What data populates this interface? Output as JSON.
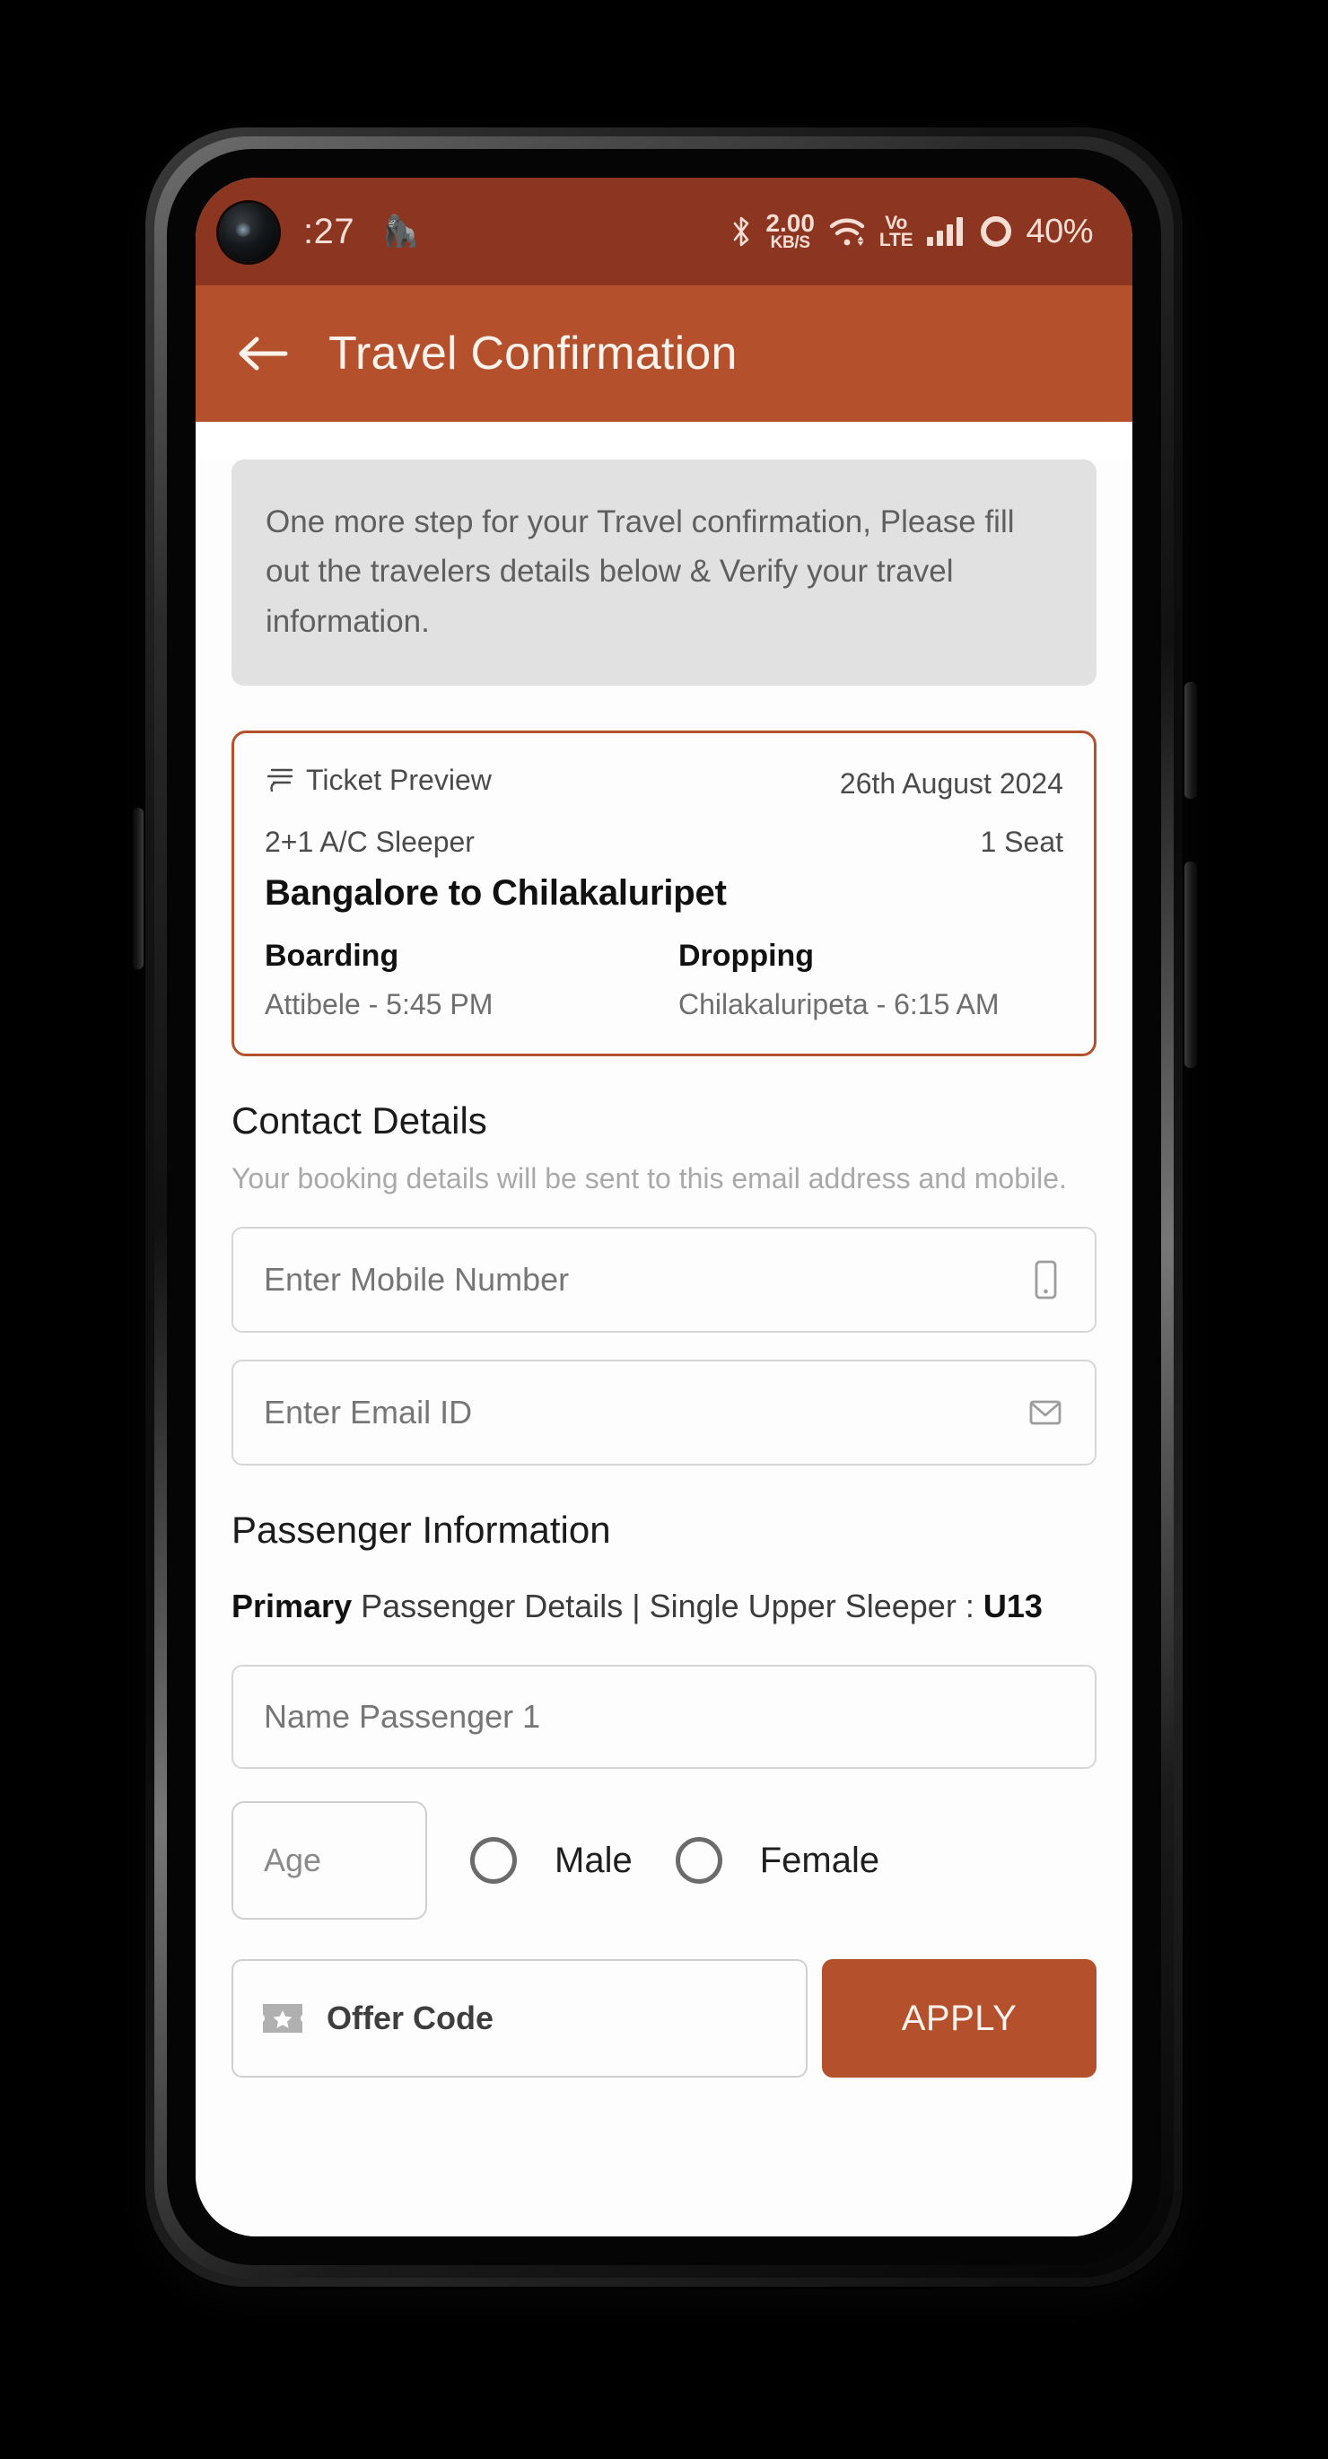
{
  "device": {
    "statusbar": {
      "time": ":27",
      "emoji_icon": "monkey-face-emoji",
      "bluetooth_icon": "bluetooth-icon",
      "data_rate_value": "2.00",
      "data_rate_unit": "KB/S",
      "wifi_icon": "wifi-icon",
      "volte_top": "Vo",
      "volte_bottom": "LTE",
      "signal_icon": "signal-bars-icon",
      "battery_icon": "battery-circle-icon",
      "battery_percent": "40%"
    }
  },
  "appbar": {
    "back_icon": "back-arrow-icon",
    "title": "Travel Confirmation"
  },
  "notice": {
    "text": "One more step for your Travel confirmation, Please fill out the travelers details below & Verify your travel information."
  },
  "ticket": {
    "bus_icon": "bus-icon",
    "preview_label": "Ticket Preview",
    "date": "26th August 2024",
    "bus_type": "2+1 A/C Sleeper",
    "seat_count": "1 Seat",
    "route": "Bangalore to Chilakaluripet",
    "boarding_label": "Boarding",
    "boarding_value": "Attibele - 5:45 PM",
    "dropping_label": "Dropping",
    "dropping_value": "Chilakaluripeta - 6:15 AM"
  },
  "contact": {
    "title": "Contact Details",
    "subtitle": "Your booking details will be sent to this email address and mobile.",
    "mobile": {
      "placeholder": "Enter Mobile Number",
      "value": "",
      "icon": "mobile-phone-icon"
    },
    "email": {
      "placeholder": "Enter Email ID",
      "value": "",
      "icon": "envelope-icon"
    }
  },
  "passenger": {
    "title": "Passenger Information",
    "primary_label": "Primary",
    "details_text": " Passenger Details | Single Upper Sleeper :",
    "seat_code": "U13",
    "name": {
      "placeholder": "Name Passenger 1",
      "value": ""
    },
    "age": {
      "placeholder": "Age",
      "value": ""
    },
    "gender": {
      "male_label": "Male",
      "female_label": "Female",
      "selected": ""
    }
  },
  "offer": {
    "icon": "ticket-star-icon",
    "placeholder": "Offer Code",
    "value": "",
    "apply_label": "APPLY"
  },
  "colors": {
    "brand": "#b4502c",
    "statusbar": "#8c3520",
    "notice_bg": "#e1e1e1"
  }
}
